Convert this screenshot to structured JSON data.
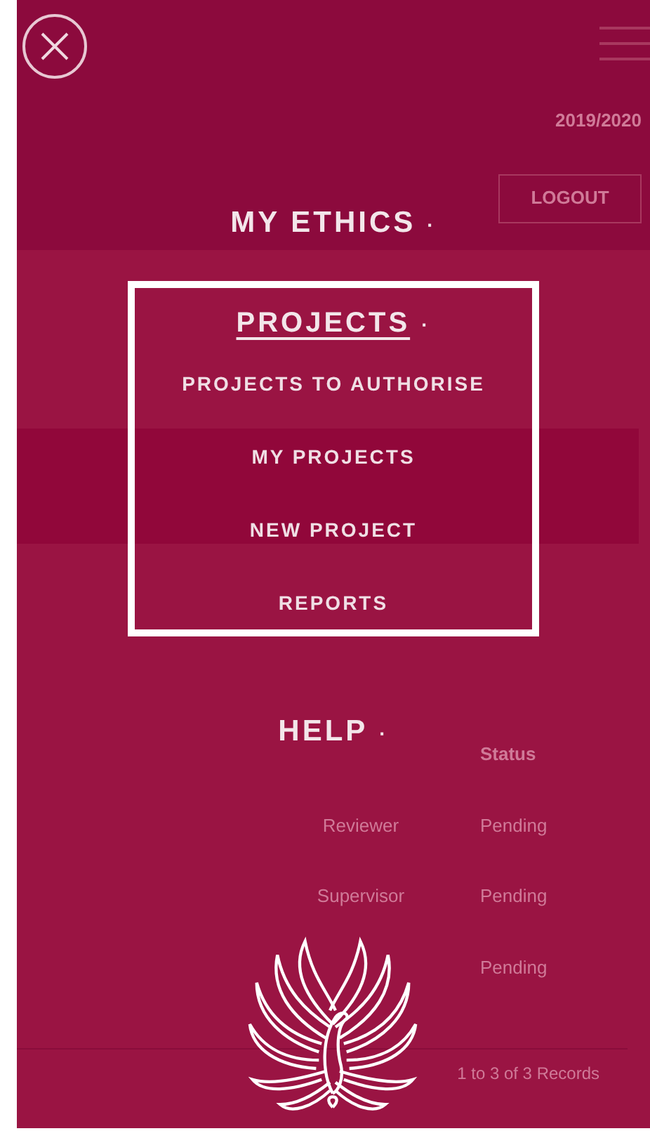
{
  "background_page": {
    "academic_year": "2019/2020",
    "logout_button": "LOGOUT",
    "table": {
      "columns": [
        "Status"
      ],
      "rows": [
        {
          "stage": "Reviewer",
          "status": "Pending"
        },
        {
          "stage": "Supervisor",
          "status": "Pending"
        },
        {
          "status": "Pending"
        }
      ]
    },
    "records": "1 to 3 of 3 Records"
  },
  "menu": {
    "items": [
      {
        "label": "MY ETHICS",
        "marker": "·",
        "expanded": false
      },
      {
        "label": "PROJECTS",
        "marker": "·",
        "expanded": true,
        "children": [
          {
            "label": "PROJECTS TO AUTHORISE"
          },
          {
            "label": "MY PROJECTS"
          },
          {
            "label": "NEW PROJECT"
          },
          {
            "label": "REPORTS"
          }
        ]
      },
      {
        "label": "HELP",
        "marker": "·",
        "expanded": false
      }
    ]
  }
}
